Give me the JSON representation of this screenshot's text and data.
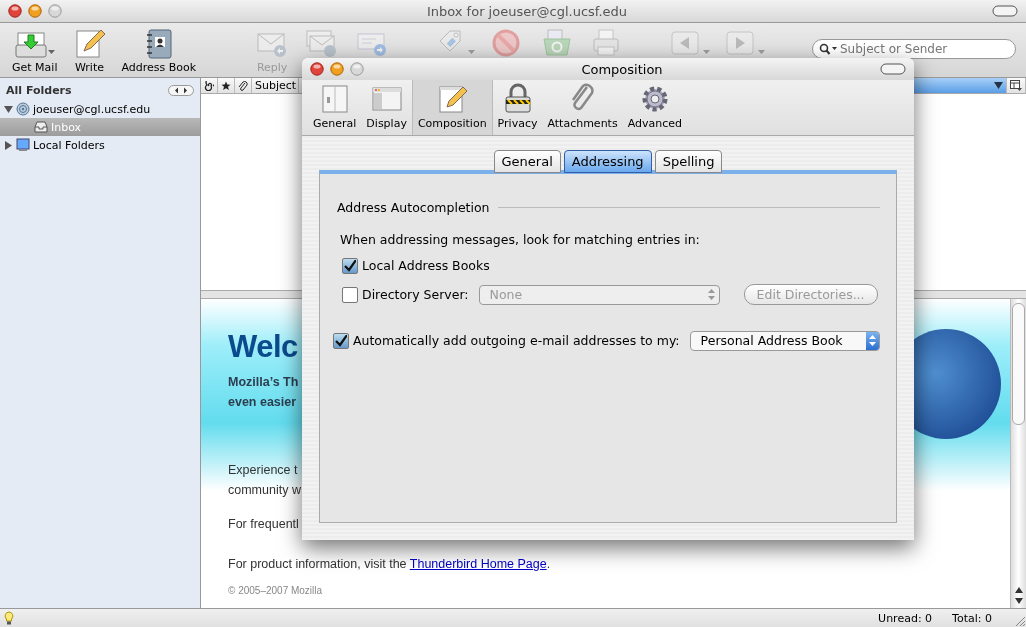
{
  "window": {
    "title": "Inbox for joeuser@cgl.ucsf.edu"
  },
  "toolbar": {
    "buttons": [
      {
        "kind": "get-mail",
        "label": "Get Mail",
        "menu": true,
        "disabled": false
      },
      {
        "kind": "write",
        "label": "Write",
        "menu": false,
        "disabled": false
      },
      {
        "kind": "address-book",
        "label": "Address Book",
        "menu": false,
        "disabled": false
      },
      {
        "kind": "reply",
        "label": "Reply",
        "menu": false,
        "disabled": true
      },
      {
        "kind": "reply-all",
        "menu": false,
        "disabled": true
      },
      {
        "kind": "forward",
        "menu": false,
        "disabled": true
      },
      {
        "kind": "tag",
        "menu": true,
        "disabled": true
      },
      {
        "kind": "junk",
        "menu": false,
        "disabled": true
      },
      {
        "kind": "delete",
        "menu": false,
        "disabled": true
      },
      {
        "kind": "print",
        "menu": false,
        "disabled": true
      },
      {
        "kind": "back",
        "menu": true,
        "disabled": true
      },
      {
        "kind": "next",
        "menu": true,
        "disabled": true
      }
    ],
    "search": {
      "placeholder": "Subject or Sender"
    }
  },
  "folders": {
    "header": "All Folders",
    "items": [
      {
        "kind": "account",
        "label": "joeuser@cgl.ucsf.edu",
        "expanded": true,
        "selected": false,
        "children": [
          {
            "kind": "inbox",
            "label": "Inbox",
            "selected": true
          }
        ]
      },
      {
        "kind": "local",
        "label": "Local Folders",
        "expanded": false,
        "selected": false
      }
    ]
  },
  "thread_pane": {
    "columns": [
      {
        "kind": "thread"
      },
      {
        "kind": "star"
      },
      {
        "kind": "attachment"
      },
      {
        "kind": "text",
        "label": "Subject"
      },
      {
        "kind": "sorted"
      }
    ]
  },
  "welcome": {
    "heading": "Welc",
    "subtitle": [
      "Mozilla’s Th",
      "even easier"
    ],
    "paragraphs": [
      "Experience t",
      "community w",
      "For frequentl"
    ],
    "product": {
      "before": "For product information, visit the ",
      "link": "Thunderbird Home Page",
      "after": "."
    },
    "copyright": "© 2005–2007 Mozilla"
  },
  "status_bar": {
    "unread": "Unread: 0",
    "total": "Total: 0"
  },
  "dialog": {
    "title": "Composition",
    "panes": [
      {
        "kind": "general",
        "label": "General",
        "selected": false
      },
      {
        "kind": "display",
        "label": "Display",
        "selected": false
      },
      {
        "kind": "composition",
        "label": "Composition",
        "selected": true
      },
      {
        "kind": "privacy",
        "label": "Privacy",
        "selected": false
      },
      {
        "kind": "attachments",
        "label": "Attachments",
        "selected": false
      },
      {
        "kind": "advanced",
        "label": "Advanced",
        "selected": false
      }
    ],
    "tabs": [
      {
        "label": "General",
        "selected": false
      },
      {
        "label": "Addressing",
        "selected": true
      },
      {
        "label": "Spelling",
        "selected": false
      }
    ],
    "group": {
      "legend": "Address Autocompletion",
      "intro": "When addressing messages, look for matching entries in:",
      "local": {
        "label": "Local Address Books",
        "checked": true
      },
      "directory": {
        "label": "Directory Server:",
        "checked": false,
        "select": {
          "value": "None",
          "disabled": true
        },
        "button": {
          "label": "Edit Directories...",
          "disabled": true
        }
      }
    },
    "auto_add": {
      "label": "Automatically add outgoing e-mail addresses to my:",
      "checked": true,
      "select": {
        "value": "Personal Address Book",
        "disabled": false
      }
    }
  }
}
